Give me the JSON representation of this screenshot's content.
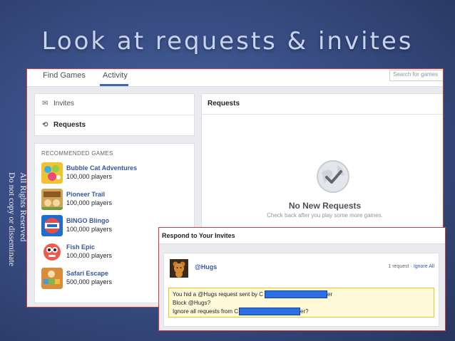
{
  "slide": {
    "title": "Look at requests & invites",
    "watermark_line1": "All Rights Reserved",
    "watermark_line2": "Do not copy or disseminate"
  },
  "fb_tabs": {
    "find_games": "Find Games",
    "activity": "Activity",
    "search_placeholder": "Search for games"
  },
  "nav": {
    "invites_label": "Invites",
    "requests_label": "Requests"
  },
  "recommended": {
    "heading": "RECOMMENDED GAMES",
    "games": [
      {
        "name": "Bubble Cat Adventures",
        "players": "100,000 players"
      },
      {
        "name": "Pioneer Trail",
        "players": "100,000 players"
      },
      {
        "name": "BINGO Blingo",
        "players": "100,000 players"
      },
      {
        "name": "Fish Epic",
        "players": "100,000 players"
      },
      {
        "name": "Safari Escape",
        "players": "500,000 players"
      }
    ]
  },
  "requests_panel": {
    "title": "Requests",
    "empty_title": "No New Requests",
    "empty_subtitle": "Check back after you play some more games."
  },
  "invites_panel": {
    "title": "Respond to Your Invites",
    "app_name": "@Hugs",
    "request_count": "1 request",
    "separator": " · ",
    "ignore_all": "Ignore All",
    "line1_prefix": "You hid a @Hugs request sent by C",
    "line1_suffix": "er",
    "line2": "Block @Hugs?",
    "line3_prefix": "Ignore all requests from C",
    "line3_suffix": "er?"
  },
  "colors": {
    "facebook_blue": "#4267b2",
    "link_blue": "#365899",
    "highlight_border": "#d23b3b",
    "notice_yellow": "#fff9d7",
    "redaction_blue": "#2b6fe3"
  }
}
